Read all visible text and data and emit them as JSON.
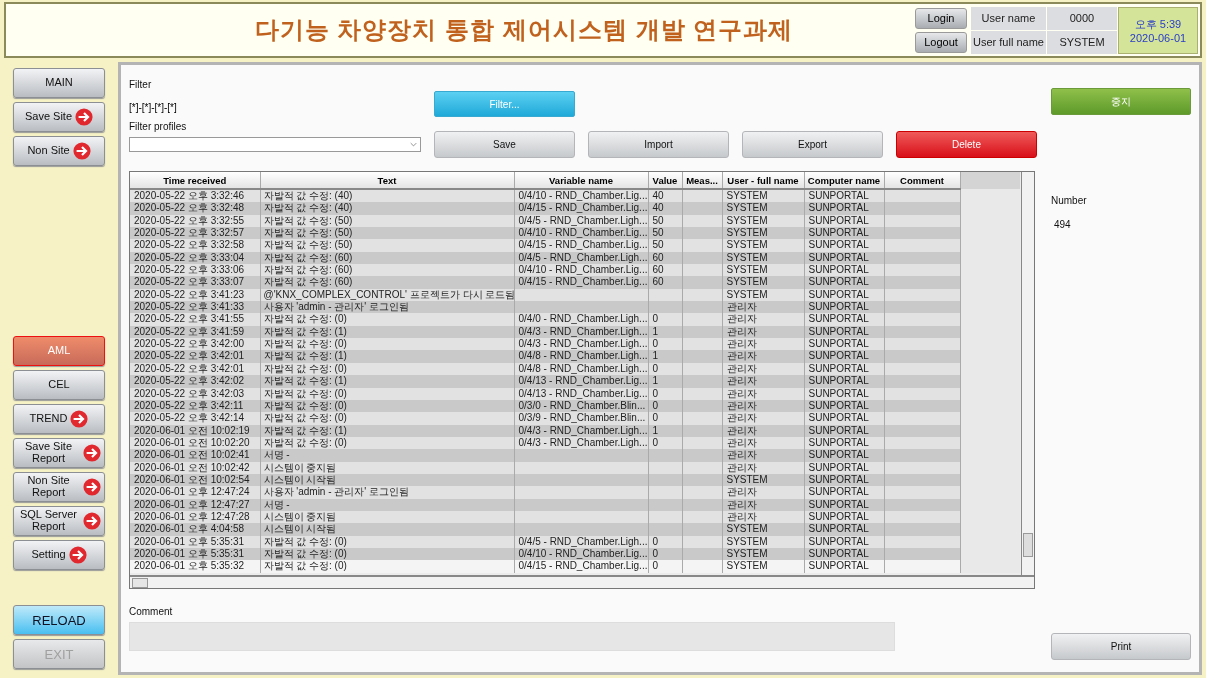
{
  "header": {
    "title": "다기능 차양장치 통합 제어시스템 개발 연구과제",
    "login_button": "Login",
    "logout_button": "Logout",
    "user_name_label": "User name",
    "user_name": "0000",
    "user_full_name_label": "User full name",
    "user_full_name": "SYSTEM",
    "clock_time": "오후 5:39",
    "clock_date": "2020-06-01"
  },
  "sidebar": {
    "top_items": [
      {
        "label": "MAIN",
        "arrow": false,
        "selected": false
      },
      {
        "label": "Save Site",
        "arrow": true,
        "selected": false
      },
      {
        "label": "Non Site",
        "arrow": true,
        "selected": false
      }
    ],
    "bottom_items": [
      {
        "label": "AML",
        "arrow": false,
        "selected": true
      },
      {
        "label": "CEL",
        "arrow": false,
        "selected": false
      },
      {
        "label": "TREND",
        "arrow": true,
        "selected": false
      },
      {
        "label": "Save Site Report",
        "arrow": true,
        "selected": false
      },
      {
        "label": "Non Site Report",
        "arrow": true,
        "selected": false
      },
      {
        "label": "SQL Server Report",
        "arrow": true,
        "selected": false
      },
      {
        "label": "Setting",
        "arrow": true,
        "selected": false
      }
    ],
    "reload_button": {
      "label": "RELOAD",
      "disabled": false
    },
    "exit_button": {
      "label": "EXIT",
      "disabled": true
    }
  },
  "filter": {
    "label": "Filter",
    "value": "[*]-[*]-[*]-[*]",
    "filter_button": "Filter...",
    "profiles_label": "Filter profiles",
    "buttons": [
      {
        "label": "Save",
        "kind": "normal"
      },
      {
        "label": "Import",
        "kind": "normal"
      },
      {
        "label": "Export",
        "kind": "normal"
      },
      {
        "label": "Delete",
        "kind": "danger"
      }
    ]
  },
  "stop_button": "중지",
  "number_label": "Number",
  "number_value": "494",
  "table": {
    "columns": [
      "Time received",
      "Text",
      "Variable name",
      "Value",
      "Meas...",
      "User - full name",
      "Computer name",
      "Comment"
    ],
    "rows": [
      {
        "time": "2020-05-22 오후 3:32:46",
        "text": "자발적 값 수정: (40)",
        "variable": "0/4/10 - RND_Chamber.Lig...",
        "value": "40",
        "user": "SYSTEM",
        "computer": "SUNPORTAL",
        "selected": false
      },
      {
        "time": "2020-05-22 오후 3:32:48",
        "text": "자발적 값 수정: (40)",
        "variable": "0/4/15 - RND_Chamber.Lig...",
        "value": "40",
        "user": "SYSTEM",
        "computer": "SUNPORTAL",
        "selected": false
      },
      {
        "time": "2020-05-22 오후 3:32:55",
        "text": "자발적 값 수정: (50)",
        "variable": "0/4/5 - RND_Chamber.Ligh...",
        "value": "50",
        "user": "SYSTEM",
        "computer": "SUNPORTAL",
        "selected": false
      },
      {
        "time": "2020-05-22 오후 3:32:57",
        "text": "자발적 값 수정: (50)",
        "variable": "0/4/10 - RND_Chamber.Lig...",
        "value": "50",
        "user": "SYSTEM",
        "computer": "SUNPORTAL",
        "selected": false
      },
      {
        "time": "2020-05-22 오후 3:32:58",
        "text": "자발적 값 수정: (50)",
        "variable": "0/4/15 - RND_Chamber.Lig...",
        "value": "50",
        "user": "SYSTEM",
        "computer": "SUNPORTAL",
        "selected": false
      },
      {
        "time": "2020-05-22 오후 3:33:04",
        "text": "자발적 값 수정: (60)",
        "variable": "0/4/5 - RND_Chamber.Ligh...",
        "value": "60",
        "user": "SYSTEM",
        "computer": "SUNPORTAL",
        "selected": false
      },
      {
        "time": "2020-05-22 오후 3:33:06",
        "text": "자발적 값 수정: (60)",
        "variable": "0/4/10 - RND_Chamber.Lig...",
        "value": "60",
        "user": "SYSTEM",
        "computer": "SUNPORTAL",
        "selected": false
      },
      {
        "time": "2020-05-22 오후 3:33:07",
        "text": "자발적 값 수정: (60)",
        "variable": "0/4/15 - RND_Chamber.Lig...",
        "value": "60",
        "user": "SYSTEM",
        "computer": "SUNPORTAL",
        "selected": false
      },
      {
        "time": "2020-05-22 오후 3:41:23",
        "text": "@'KNX_COMPLEX_CONTROL' 프로젝트가 다시 로드됨",
        "user": "SYSTEM",
        "computer": "SUNPORTAL",
        "selected": false
      },
      {
        "time": "2020-05-22 오후 3:41:33",
        "text": "사용자 'admin - 관리자' 로그인됨",
        "user": "관리자",
        "computer": "SUNPORTAL",
        "selected": false
      },
      {
        "time": "2020-05-22 오후 3:41:55",
        "text": "자발적 값 수정: (0)",
        "variable": "0/4/0 - RND_Chamber.Ligh...",
        "value": "0",
        "user": "관리자",
        "computer": "SUNPORTAL",
        "selected": false
      },
      {
        "time": "2020-05-22 오후 3:41:59",
        "text": "자발적 값 수정: (1)",
        "variable": "0/4/3 - RND_Chamber.Ligh...",
        "value": "1",
        "user": "관리자",
        "computer": "SUNPORTAL",
        "selected": false
      },
      {
        "time": "2020-05-22 오후 3:42:00",
        "text": "자발적 값 수정: (0)",
        "variable": "0/4/3 - RND_Chamber.Ligh...",
        "value": "0",
        "user": "관리자",
        "computer": "SUNPORTAL",
        "selected": false
      },
      {
        "time": "2020-05-22 오후 3:42:01",
        "text": "자발적 값 수정: (1)",
        "variable": "0/4/8 - RND_Chamber.Ligh...",
        "value": "1",
        "user": "관리자",
        "computer": "SUNPORTAL",
        "selected": false
      },
      {
        "time": "2020-05-22 오후 3:42:01",
        "text": "자발적 값 수정: (0)",
        "variable": "0/4/8 - RND_Chamber.Ligh...",
        "value": "0",
        "user": "관리자",
        "computer": "SUNPORTAL",
        "selected": false
      },
      {
        "time": "2020-05-22 오후 3:42:02",
        "text": "자발적 값 수정: (1)",
        "variable": "0/4/13 - RND_Chamber.Lig...",
        "value": "1",
        "user": "관리자",
        "computer": "SUNPORTAL",
        "selected": false
      },
      {
        "time": "2020-05-22 오후 3:42:03",
        "text": "자발적 값 수정: (0)",
        "variable": "0/4/13 - RND_Chamber.Lig...",
        "value": "0",
        "user": "관리자",
        "computer": "SUNPORTAL",
        "selected": false
      },
      {
        "time": "2020-05-22 오후 3:42:11",
        "text": "자발적 값 수정: (0)",
        "variable": "0/3/0 - RND_Chamber.Blin...",
        "value": "0",
        "user": "관리자",
        "computer": "SUNPORTAL",
        "selected": false
      },
      {
        "time": "2020-05-22 오후 3:42:14",
        "text": "자발적 값 수정: (0)",
        "variable": "0/3/9 - RND_Chamber.Blin...",
        "value": "0",
        "user": "관리자",
        "computer": "SUNPORTAL",
        "selected": false
      },
      {
        "time": "2020-06-01 오전 10:02:19",
        "text": "자발적 값 수정: (1)",
        "variable": "0/4/3 - RND_Chamber.Ligh...",
        "value": "1",
        "user": "관리자",
        "computer": "SUNPORTAL",
        "selected": false
      },
      {
        "time": "2020-06-01 오전 10:02:20",
        "text": "자발적 값 수정: (0)",
        "variable": "0/4/3 - RND_Chamber.Ligh...",
        "value": "0",
        "user": "관리자",
        "computer": "SUNPORTAL",
        "selected": false
      },
      {
        "time": "2020-06-01 오전 10:02:41",
        "text": "서명 -",
        "user": "관리자",
        "computer": "SUNPORTAL",
        "selected": false
      },
      {
        "time": "2020-06-01 오전 10:02:42",
        "text": "시스템이 중지됨",
        "user": "관리자",
        "computer": "SUNPORTAL",
        "selected": false
      },
      {
        "time": "2020-06-01 오전 10:02:54",
        "text": "시스템이 시작됨",
        "user": "SYSTEM",
        "computer": "SUNPORTAL",
        "selected": false
      },
      {
        "time": "2020-06-01 오후 12:47:24",
        "text": "사용자 'admin - 관리자' 로그인됨",
        "user": "관리자",
        "computer": "SUNPORTAL",
        "selected": false
      },
      {
        "time": "2020-06-01 오후 12:47:27",
        "text": "서명 -",
        "user": "관리자",
        "computer": "SUNPORTAL",
        "selected": false
      },
      {
        "time": "2020-06-01 오후 12:47:28",
        "text": "시스템이 중지됨",
        "user": "관리자",
        "computer": "SUNPORTAL",
        "selected": false
      },
      {
        "time": "2020-06-01 오후 4:04:58",
        "text": "시스템이 시작됨",
        "user": "SYSTEM",
        "computer": "SUNPORTAL",
        "selected": false
      },
      {
        "time": "2020-06-01 오후 5:35:31",
        "text": "자발적 값 수정: (0)",
        "variable": "0/4/5 - RND_Chamber.Ligh...",
        "value": "0",
        "user": "SYSTEM",
        "computer": "SUNPORTAL",
        "selected": false
      },
      {
        "time": "2020-06-01 오후 5:35:31",
        "text": "자발적 값 수정: (0)",
        "variable": "0/4/10 - RND_Chamber.Lig...",
        "value": "0",
        "user": "SYSTEM",
        "computer": "SUNPORTAL",
        "selected": false
      },
      {
        "time": "2020-06-01 오후 5:35:32",
        "text": "자발적 값 수정: (0)",
        "variable": "0/4/15 - RND_Chamber.Lig...",
        "value": "0",
        "user": "SYSTEM",
        "computer": "SUNPORTAL",
        "selected": true
      }
    ]
  },
  "comment_label": "Comment",
  "print_button": "Print"
}
